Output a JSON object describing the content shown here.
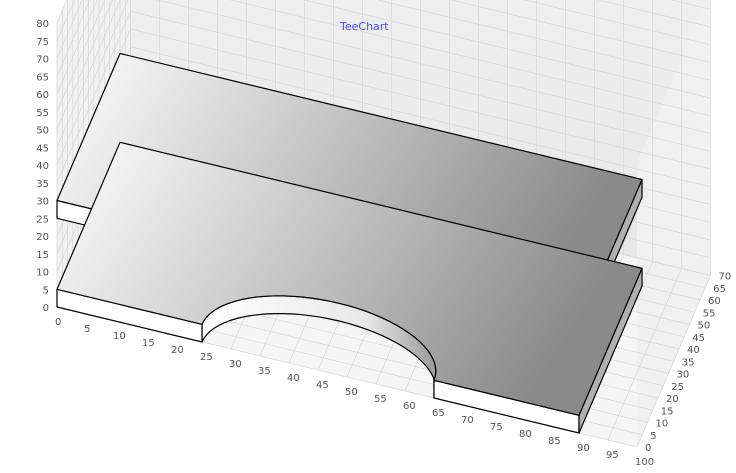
{
  "chart_data": {
    "type": "3d-surface",
    "title": "TeeChart",
    "axes": {
      "x": {
        "range": [
          0,
          100
        ],
        "ticks": [
          0,
          5,
          10,
          15,
          20,
          25,
          30,
          35,
          40,
          45,
          50,
          55,
          60,
          65,
          70,
          75,
          80,
          85,
          90,
          95,
          100
        ]
      },
      "y": {
        "range": [
          0,
          80
        ],
        "ticks": [
          0,
          5,
          10,
          15,
          20,
          25,
          30,
          35,
          40,
          45,
          50,
          55,
          60,
          65,
          70,
          75,
          80
        ]
      },
      "z": {
        "range": [
          0,
          70
        ],
        "ticks": [
          0,
          5,
          10,
          15,
          20,
          25,
          30,
          35,
          40,
          45,
          50,
          55,
          60,
          65,
          70
        ]
      }
    },
    "grid": true,
    "slabs": [
      {
        "name": "upper",
        "y_bottom": 25,
        "y_top": 30,
        "x_range": [
          0,
          90
        ],
        "z_range": [
          0,
          60
        ],
        "cutout_x_range": [
          25,
          65
        ],
        "cutout_z_max": 20
      },
      {
        "name": "lower",
        "y_bottom": 0,
        "y_top": 5,
        "x_range": [
          0,
          90
        ],
        "z_range": [
          0,
          60
        ],
        "cutout_x_range": [
          25,
          65
        ],
        "cutout_z_max": 20
      }
    ]
  },
  "colors": {
    "title": "#4a4aff",
    "face_light": "#ffffff",
    "face_dark": "#8a8a8a",
    "outline": "#000000",
    "grid": "#d6d6d6",
    "wall": "#efefef"
  }
}
